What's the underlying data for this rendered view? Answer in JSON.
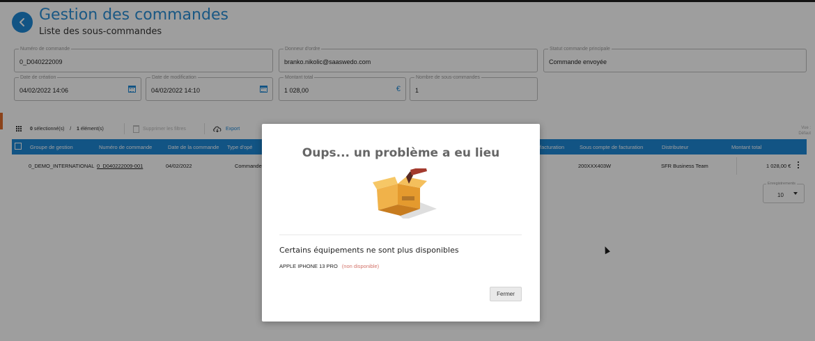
{
  "header": {
    "title": "Gestion des commandes",
    "subtitle": "Liste des sous-commandes"
  },
  "fields": {
    "order_number": {
      "label": "Numéro de commande",
      "value": "0_D040222009"
    },
    "principal": {
      "label": "Donneur d'ordre",
      "value": "branko.nikolic@saaswedo.com"
    },
    "main_status": {
      "label": "Statut commande principale",
      "value": "Commande envoyée"
    },
    "created_date": {
      "label": "Date de création",
      "value": "04/02/2022 14:06"
    },
    "modified_date": {
      "label": "Date de modification",
      "value": "04/02/2022 14:10"
    },
    "total_amount": {
      "label": "Montant total",
      "value": "1 028,00",
      "currency": "€"
    },
    "sub_orders_count": {
      "label": "Nombre de sous-commandes",
      "value": "1"
    }
  },
  "toolbar": {
    "selected_count": "0",
    "selected_label": "sélectionné(s)",
    "separator": "/",
    "total_count": "1",
    "total_label": "élément(s)",
    "clear_filters": "Supprimer les filtres",
    "export": "Export"
  },
  "view": {
    "line1": "Vue :",
    "line2": "Défaut"
  },
  "grid": {
    "columns": [
      "Groupe de gestion",
      "Numéro de commande",
      "Date de la commande",
      "Type d'opé",
      "facturation",
      "Sous compte de facturation",
      "Distributeur",
      "Montant total"
    ],
    "rows": [
      {
        "group": "0_DEMO_INTERNATIONAL",
        "order_number": "0_D040222009-001",
        "order_date": "04/02/2022",
        "operation_type": "Commande",
        "sub_account": "200XXX403W",
        "distributor": "SFR Business Team",
        "amount": "1 028,00 €"
      }
    ]
  },
  "pagination": {
    "label": "Enregistrements",
    "value": "10"
  },
  "modal": {
    "title": "Oups... un problème a eu lieu",
    "message": "Certains équipements ne sont plus disponibles",
    "item_name": "APPLE IPHONE 13 PRO",
    "item_status": "(non disponible)",
    "close_label": "Fermer"
  },
  "colors": {
    "accent": "#1e88d6",
    "overlay": "rgba(0,0,0,0.38)",
    "unavailable": "#d3736a"
  },
  "icons": [
    "back-arrow-icon",
    "calendar-icon",
    "grid-icon",
    "trash-icon",
    "cloud-download-icon",
    "kebab-icon",
    "chevron-down-icon",
    "open-box-icon"
  ]
}
